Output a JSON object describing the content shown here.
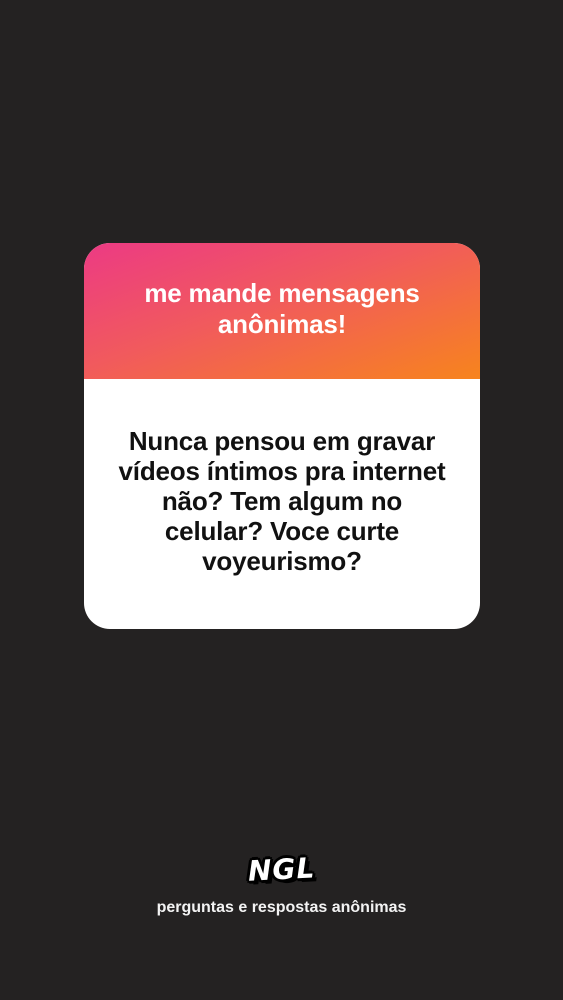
{
  "card": {
    "title": "me mande mensagens anônimas!",
    "question": "Nunca pensou em gravar vídeos íntimos pra internet não? Tem algum no celular? Voce curte voyeurismo?",
    "gradient_colors": [
      "#ec3a84",
      "#f15a5d",
      "#f7841d"
    ]
  },
  "footer": {
    "logo_text": "NGL",
    "tagline": "perguntas e respostas anônimas"
  }
}
